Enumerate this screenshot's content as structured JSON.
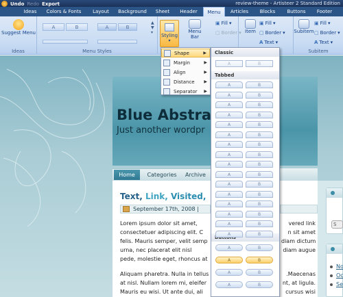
{
  "titlebar": {
    "undo": "Undo",
    "redo": "Redo",
    "export": "Export",
    "title": "review-theme - Artisteer 2 Standard Edition"
  },
  "tabs": [
    "Ideas",
    "Colors & Fonts",
    "Layout",
    "Background",
    "Sheet",
    "Header",
    "Menu",
    "Articles",
    "Blocks",
    "Buttons",
    "Footer"
  ],
  "active_tab": "Menu",
  "ribbon": {
    "ideas": {
      "button": "Suggest Menu",
      "group": "Ideas"
    },
    "menu_styles": {
      "group": "Menu Styles",
      "items": [
        "A",
        "B",
        "A",
        "B",
        "A",
        "B"
      ]
    },
    "styling": {
      "label": "Styling"
    },
    "menu_bar": {
      "label": "Menu Bar",
      "fill": "Fill",
      "border": "Border"
    },
    "item": {
      "label": "Item",
      "fill": "Fill",
      "border": "Border",
      "text": "Text"
    },
    "subitem": {
      "label": "Subitem",
      "fill": "Fill",
      "border": "Border",
      "text": "Text",
      "group": "Subitem"
    }
  },
  "styling_menu": {
    "items": [
      "Shape",
      "Margin",
      "Align",
      "Distance",
      "Separator"
    ]
  },
  "shape_panel": {
    "sections": [
      "Classic",
      "Tabbed",
      "Buttons"
    ],
    "a": "A",
    "b": "B"
  },
  "preview": {
    "header_title": "Blue Abstrac",
    "header_slogan": "Just another wordpr",
    "nav": [
      "Home",
      "Categories",
      "Archive"
    ],
    "post_title_parts": [
      "Text, ",
      "Link, ",
      "Visited, "
    ],
    "meta_date": "September 17th, 2008 |",
    "para1": [
      "Lorem ipsum dolor sit amet,",
      "consectetuer adipiscing elit. C",
      "felis. Mauris semper, velit semp",
      "urna, nec placerat elit nisl ",
      "pede, molestie eget, rhoncus at"
    ],
    "para2": [
      "Aliquam pharetra. Nulla in tellus",
      "at nisl. Nullam lorem mi, eleifer",
      "Mauris eu wisi. Ut ante dui, ali"
    ],
    "right1": [
      "vered link",
      "n sit amet",
      "diam dictum",
      "diam augue",
      ""
    ],
    "right2": [
      ".Maecenas",
      "nt, at ligula.",
      "cursus wisi"
    ],
    "sidebar_links": [
      "No",
      "Oc",
      "Se"
    ],
    "search_btn": "S"
  },
  "colors": {
    "accent": "#2c5587",
    "highlight": "#fbd06a",
    "header_bg": "#4b95a9"
  }
}
